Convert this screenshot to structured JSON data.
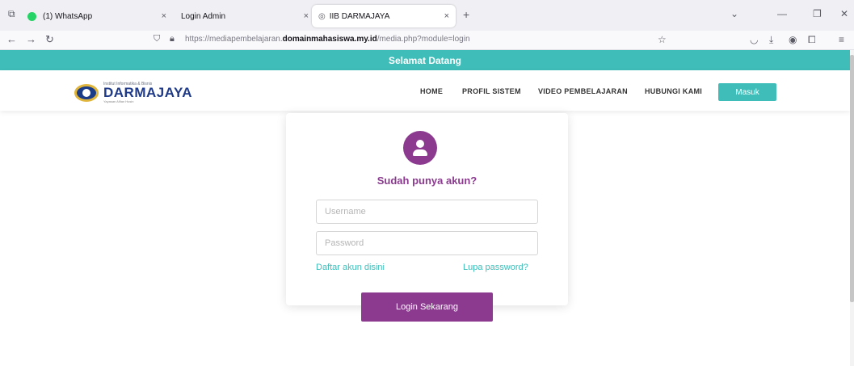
{
  "browser": {
    "tabs": [
      {
        "title": "(1) WhatsApp",
        "favicon_color": "#25d366",
        "active": false
      },
      {
        "title": "Login Admin",
        "favicon_color": "",
        "active": false
      },
      {
        "title": "IIB DARMAJAYA",
        "favicon_color": "#5b5b66",
        "active": true
      }
    ],
    "new_tab": "+",
    "close_glyph": "×",
    "url_prefix": "https://mediapembelajaran.",
    "url_domain": "domainmahasiswa.my.id",
    "url_suffix": "/media.php?module=login",
    "icons": [
      "tab-overview-icon",
      "back-icon",
      "forward-icon",
      "reload-icon",
      "shield-icon",
      "lock-icon",
      "bookmark-star-icon",
      "pocket-icon",
      "download-icon",
      "account-icon",
      "extensions-icon",
      "menu-icon",
      "list-all-tabs-icon",
      "minimize-icon",
      "restore-icon",
      "close-window-icon"
    ]
  },
  "page": {
    "welcome_bar": "Selamat Datang",
    "logo": {
      "small_text": "Institut Informatika & Bisnis",
      "main_text": "DARMAJAYA",
      "tagline": "Yayasan Alfian Husin"
    },
    "menu": {
      "home": "HOME",
      "profil": "PROFIL SISTEM",
      "video": "VIDEO PEMBELAJARAN",
      "hubungi": "HUBUNGI KAMI",
      "masuk": "Masuk"
    },
    "login": {
      "heading": "Sudah punya akun?",
      "username_placeholder": "Username",
      "password_placeholder": "Password",
      "register_link": "Daftar akun disini",
      "forgot_link": "Lupa password?",
      "submit": "Login Sekarang"
    },
    "colors": {
      "teal": "#3fbdb9",
      "purple": "#8b3a8f",
      "logo_blue": "#1f3a88"
    }
  }
}
